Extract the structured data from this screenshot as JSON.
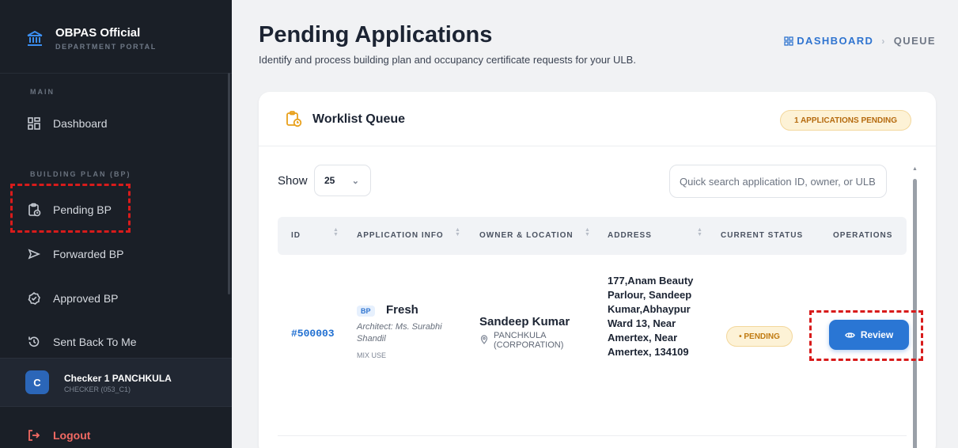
{
  "brand": {
    "title": "OBPAS Official",
    "subtitle": "DEPARTMENT PORTAL"
  },
  "sidebar": {
    "sections": [
      {
        "label": "MAIN"
      },
      {
        "label": "BUILDING PLAN (BP)"
      }
    ],
    "items": [
      {
        "label": "Dashboard",
        "icon": "dashboard-grid-icon"
      },
      {
        "label": "Pending BP",
        "icon": "clipboard-clock-icon"
      },
      {
        "label": "Forwarded BP",
        "icon": "send-icon"
      },
      {
        "label": "Approved BP",
        "icon": "check-circle-icon"
      },
      {
        "label": "Sent Back To Me",
        "icon": "history-icon"
      }
    ],
    "user": {
      "initial": "C",
      "name": "Checker 1 PANCHKULA",
      "role": "CHECKER (053_C1)"
    },
    "logout_label": "Logout"
  },
  "page": {
    "title": "Pending Applications",
    "subtitle": "Identify and process building plan and occupancy certificate requests for your ULB.",
    "breadcrumb": {
      "dashboard": "DASHBOARD",
      "separator": "›",
      "current": "QUEUE"
    }
  },
  "worklist": {
    "title": "Worklist Queue",
    "badge": "1 APPLICATIONS PENDING",
    "show_label": "Show",
    "page_size": "25",
    "search_placeholder": "Quick search application ID, owner, or ULB",
    "columns": [
      "ID",
      "APPLICATION INFO",
      "OWNER & LOCATION",
      "ADDRESS",
      "CURRENT STATUS",
      "OPERATIONS"
    ],
    "rows": [
      {
        "id": "#500003",
        "category": "BP",
        "type": "Fresh",
        "architect": "Architect: Ms. Surabhi Shandil",
        "usage": "MIX USE",
        "owner": "Sandeep Kumar",
        "location": "PANCHKULA (CORPORATION)",
        "address": "177,Anam Beauty Parlour, Sandeep Kumar,Abhaypur Ward 13, Near Amertex, Near Amertex, 134109",
        "status": "• PENDING",
        "action": "Review"
      }
    ]
  },
  "colors": {
    "sidebar_bg": "#1a1f27",
    "accent": "#2a76d4",
    "pending": "#c07a10",
    "logout": "#f26a63"
  }
}
